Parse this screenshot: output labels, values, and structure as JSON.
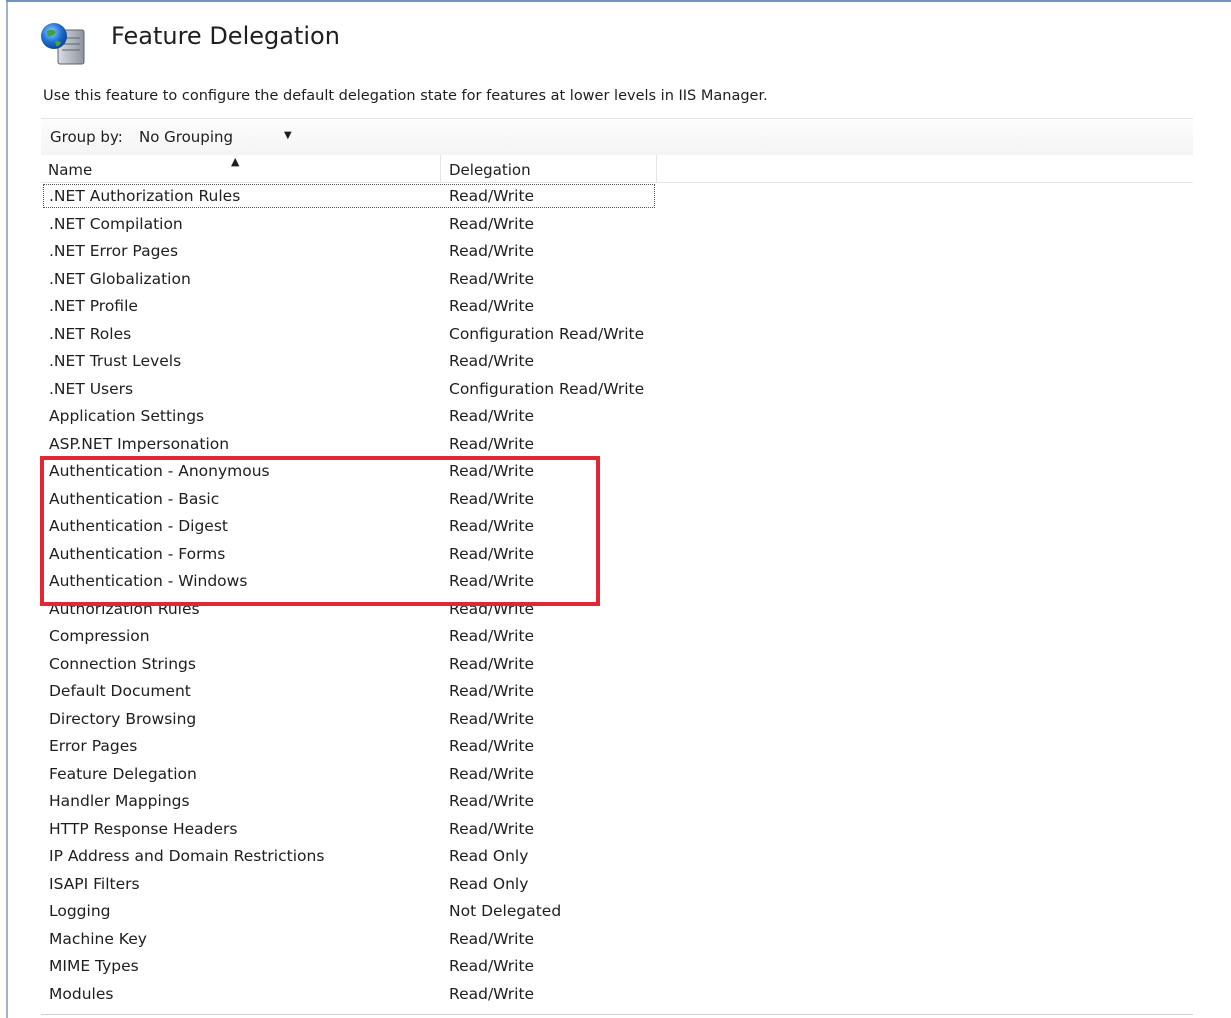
{
  "page": {
    "title": "Feature Delegation",
    "description": "Use this feature to configure the default delegation state for features at lower levels in IIS Manager.",
    "icon": "iis-globe-server-icon"
  },
  "toolbar": {
    "group_by_label": "Group by:",
    "group_by_value": "No Grouping"
  },
  "table": {
    "columns": {
      "name": "Name",
      "delegation": "Delegation"
    },
    "sort": {
      "column": "Name",
      "direction": "ascending"
    },
    "rows": [
      {
        "name": ".NET Authorization Rules",
        "delegation": "Read/Write"
      },
      {
        "name": ".NET Compilation",
        "delegation": "Read/Write"
      },
      {
        "name": ".NET Error Pages",
        "delegation": "Read/Write"
      },
      {
        "name": ".NET Globalization",
        "delegation": "Read/Write"
      },
      {
        "name": ".NET Profile",
        "delegation": "Read/Write"
      },
      {
        "name": ".NET Roles",
        "delegation": "Configuration Read/Write"
      },
      {
        "name": ".NET Trust Levels",
        "delegation": "Read/Write"
      },
      {
        "name": ".NET Users",
        "delegation": "Configuration Read/Write"
      },
      {
        "name": "Application Settings",
        "delegation": "Read/Write"
      },
      {
        "name": "ASP.NET Impersonation",
        "delegation": "Read/Write"
      },
      {
        "name": "Authentication - Anonymous",
        "delegation": "Read/Write"
      },
      {
        "name": "Authentication - Basic",
        "delegation": "Read/Write"
      },
      {
        "name": "Authentication - Digest",
        "delegation": "Read/Write"
      },
      {
        "name": "Authentication - Forms",
        "delegation": "Read/Write"
      },
      {
        "name": "Authentication - Windows",
        "delegation": "Read/Write"
      },
      {
        "name": "Authorization Rules",
        "delegation": "Read/Write"
      },
      {
        "name": "Compression",
        "delegation": "Read/Write"
      },
      {
        "name": "Connection Strings",
        "delegation": "Read/Write"
      },
      {
        "name": "Default Document",
        "delegation": "Read/Write"
      },
      {
        "name": "Directory Browsing",
        "delegation": "Read/Write"
      },
      {
        "name": "Error Pages",
        "delegation": "Read/Write"
      },
      {
        "name": "Feature Delegation",
        "delegation": "Read/Write"
      },
      {
        "name": "Handler Mappings",
        "delegation": "Read/Write"
      },
      {
        "name": "HTTP Response Headers",
        "delegation": "Read/Write"
      },
      {
        "name": "IP Address and Domain Restrictions",
        "delegation": "Read Only"
      },
      {
        "name": "ISAPI Filters",
        "delegation": "Read Only"
      },
      {
        "name": "Logging",
        "delegation": "Not Delegated"
      },
      {
        "name": "Machine Key",
        "delegation": "Read/Write"
      },
      {
        "name": "MIME Types",
        "delegation": "Read/Write"
      },
      {
        "name": "Modules",
        "delegation": "Read/Write"
      }
    ]
  },
  "annotation": {
    "highlight_color": "#e32636"
  }
}
